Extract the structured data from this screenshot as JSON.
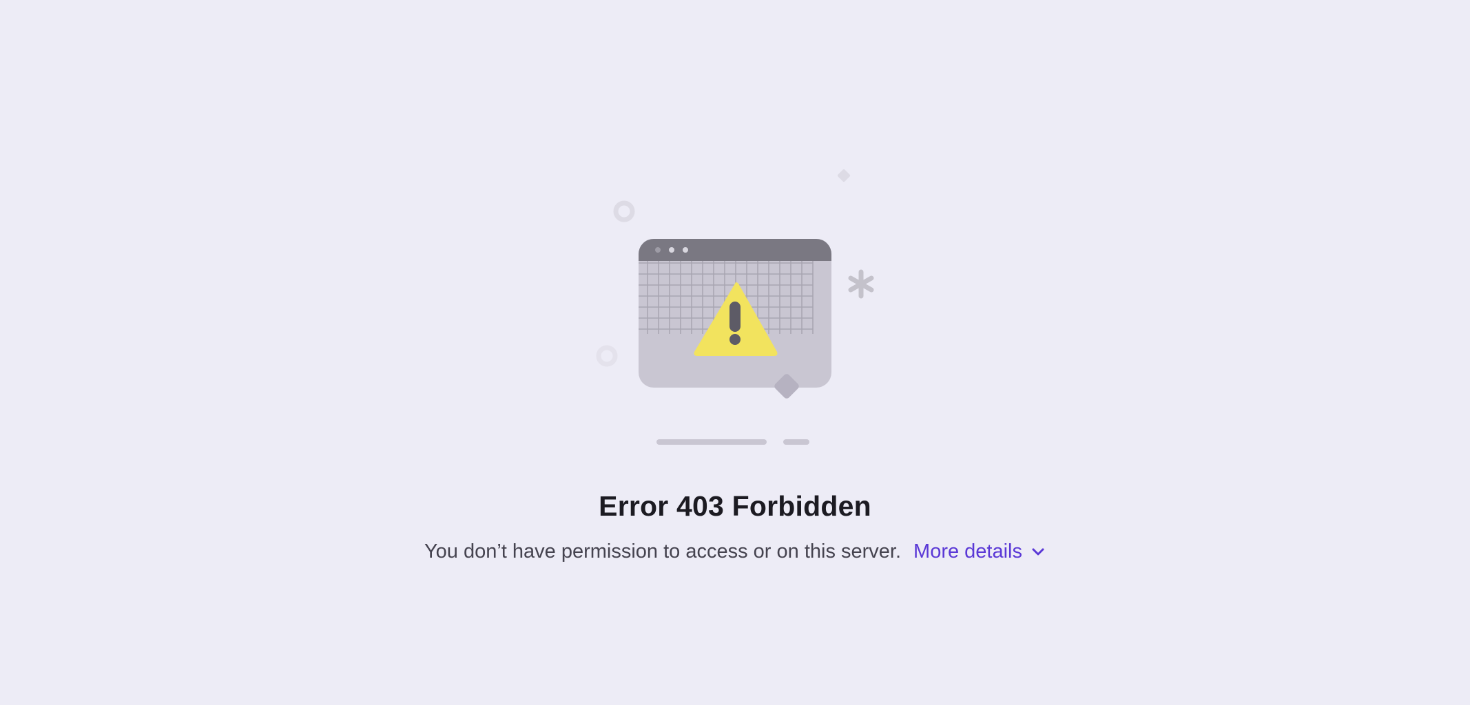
{
  "error": {
    "title": "Error 403 Forbidden",
    "message": "You don’t have permission to access or on this server.",
    "details_label": "More details"
  },
  "icons": {
    "illustration": "browser-window-warning-icon",
    "details_toggle": "chevron-down-icon"
  },
  "colors": {
    "background": "#edecf6",
    "window_body": "#c9c6d2",
    "window_titlebar": "#7a7882",
    "warning": "#f2e35e",
    "link": "#5a38d6",
    "title_text": "#1c1b22",
    "body_text": "#45434f"
  }
}
